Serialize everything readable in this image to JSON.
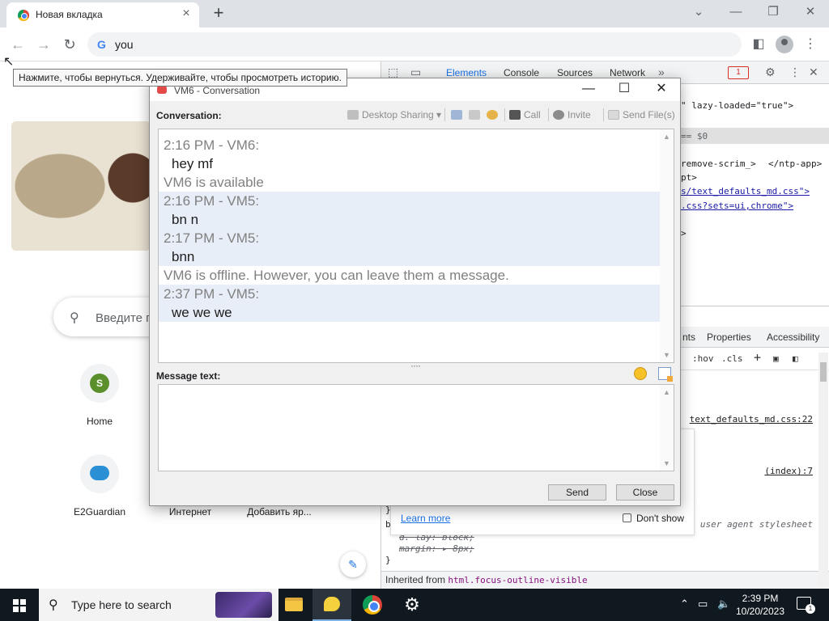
{
  "browser": {
    "tab_title": "Новая вкладка",
    "address_value": "you",
    "back_tooltip": "Нажмите, чтобы вернуться. Удерживайте, чтобы просмотреть историю."
  },
  "ntp": {
    "search_placeholder": "Введите г",
    "shortcuts": [
      {
        "label": "Home",
        "initial": "S"
      },
      {
        "label": "E2Guardian"
      },
      {
        "label": "Интернет"
      },
      {
        "label": "Добавить яр..."
      }
    ]
  },
  "devtools": {
    "tabs": [
      "Elements",
      "Console",
      "Sources",
      "Network"
    ],
    "error_count": "1",
    "code_lines": [
      "\" lazy-loaded=\"true\">",
      "== $0",
      "remove-scrim_>",
      "</ntp-app>",
      "pt>",
      "s/text_defaults_md.css\">",
      ".css?sets=ui,chrome\">",
      ">"
    ],
    "subtabs": [
      "nts",
      "Properties",
      "Accessibility"
    ],
    "filter_tokens": [
      ":hov",
      ".cls",
      "+"
    ],
    "source_1": "text_defaults_md.css:22",
    "source_2": "(index):7",
    "user_agent": "user agent stylesheet",
    "rule_1": "d. lay: block;",
    "rule_2": "margin: ▸ 8px;",
    "brace": "}",
    "inherited_label": "Inherited from",
    "inherited_element": "html.focus-outline-visible",
    "hint_learn_more": "Learn more",
    "hint_dont_show": "Don't show",
    "rule_prefix_1": "}",
    "rule_prefix_2": "b"
  },
  "dialog": {
    "title": "VM6 - Conversation",
    "conversation_label": "Conversation:",
    "toolbar": {
      "desktop_sharing": "Desktop Sharing",
      "call": "Call",
      "invite": "Invite",
      "send_files": "Send File(s)"
    },
    "messages": [
      {
        "text": "2:16 PM - VM6:",
        "kind": "header",
        "hl": false
      },
      {
        "text": "hey mf",
        "kind": "text",
        "hl": false
      },
      {
        "text": "VM6 is available",
        "kind": "status",
        "hl": false
      },
      {
        "text": "2:16 PM - VM5:",
        "kind": "header",
        "hl": true
      },
      {
        "text": " bn n",
        "kind": "text",
        "hl": true
      },
      {
        "text": "2:17 PM - VM5:",
        "kind": "header",
        "hl": true
      },
      {
        "text": "bnn",
        "kind": "text",
        "hl": true
      },
      {
        "text": "VM6 is offline. However, you can leave them a message.",
        "kind": "status",
        "hl": false
      },
      {
        "text": "2:37 PM - VM5:",
        "kind": "header",
        "hl": true
      },
      {
        "text": "we we we",
        "kind": "text",
        "hl": true
      }
    ],
    "message_text_label": "Message text:",
    "message_value": "",
    "send_label": "Send",
    "close_label": "Close"
  },
  "taskbar": {
    "search_placeholder": "Type here to search",
    "time": "2:39 PM",
    "date": "10/20/2023",
    "notification_count": "1"
  }
}
